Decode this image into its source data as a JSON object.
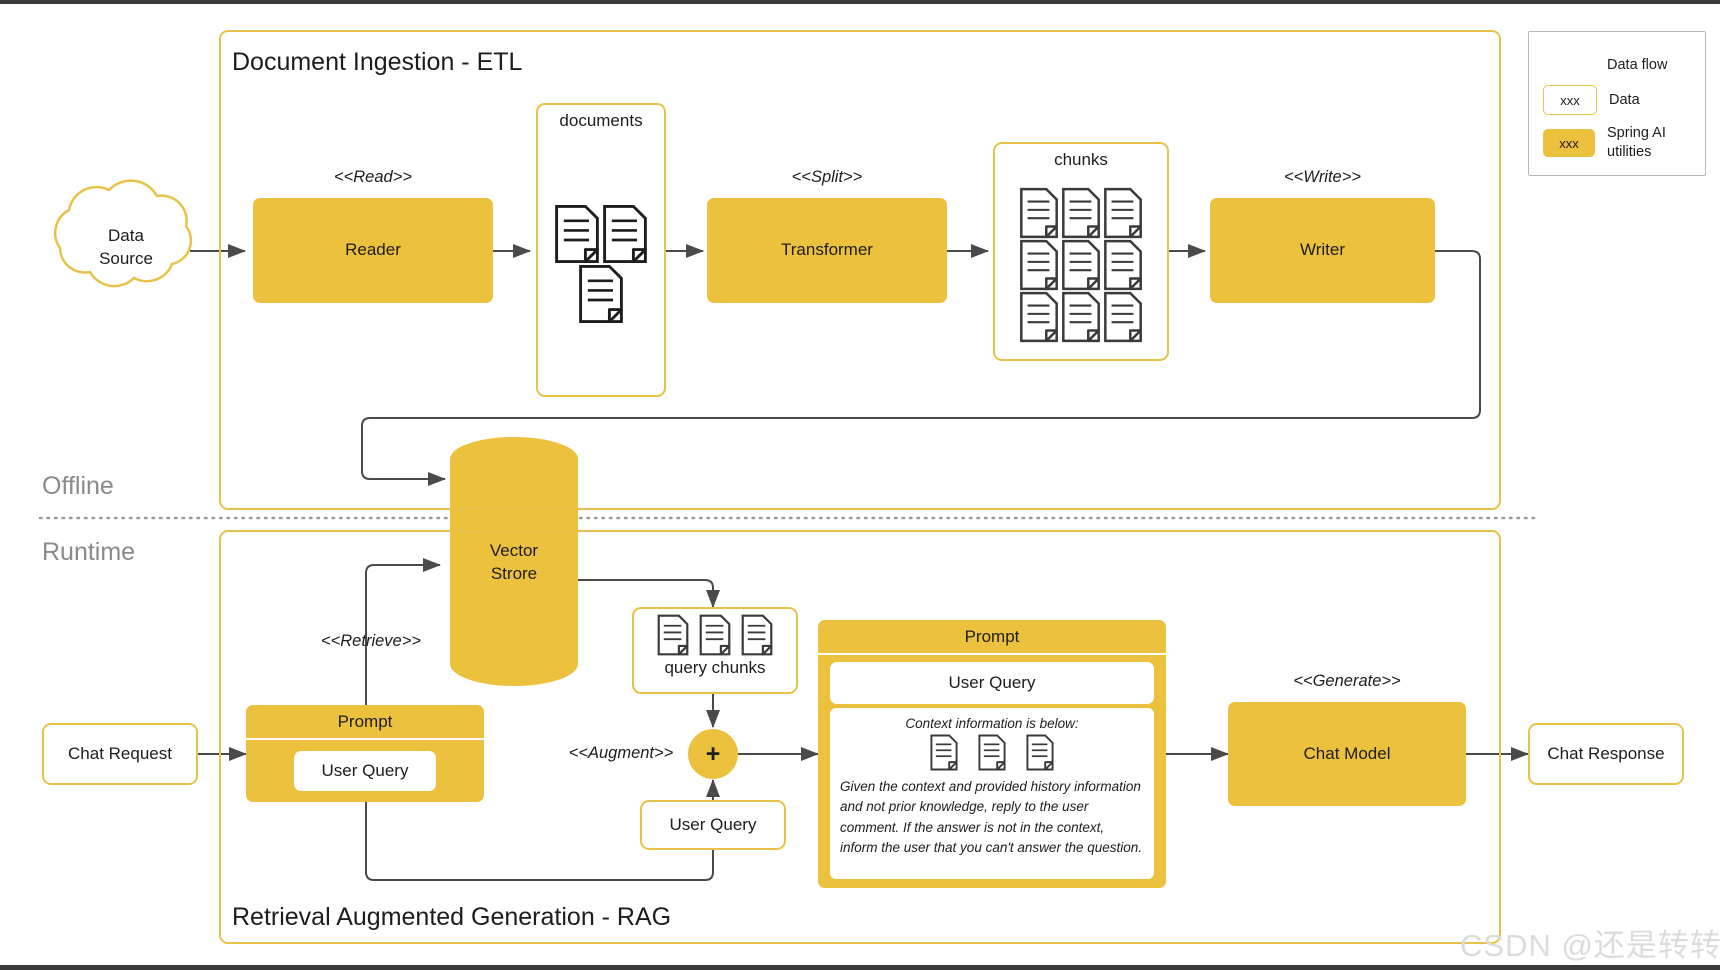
{
  "legend": {
    "rows": [
      {
        "kind": "arrow",
        "swatch_text": "",
        "label": "Data flow"
      },
      {
        "kind": "outline",
        "swatch_text": "xxx",
        "label": "Data"
      },
      {
        "kind": "fill",
        "swatch_text": "xxx",
        "label": "Spring AI utilities"
      }
    ]
  },
  "phases": {
    "offline": "Offline",
    "runtime": "Runtime"
  },
  "sections": {
    "etl_title": "Document Ingestion - ETL",
    "rag_title": "Retrieval Augmented Generation - RAG"
  },
  "etl": {
    "data_source": "Data\nSource",
    "read_stereotype": "<<Read>>",
    "reader": "Reader",
    "documents_title": "documents",
    "split_stereotype": "<<Split>>",
    "transformer": "Transformer",
    "chunks_title": "chunks",
    "write_stereotype": "<<Write>>",
    "writer": "Writer"
  },
  "store": {
    "vector_store": "Vector\nStrore"
  },
  "rag": {
    "chat_request": "Chat Request",
    "retrieve_stereotype": "<<Retrieve>>",
    "prompt_title": "Prompt",
    "prompt_user_query": "User Query",
    "query_chunks_label": "query chunks",
    "augment_stereotype": "<<Augment>>",
    "plus_symbol": "+",
    "user_query_box": "User Query",
    "big_prompt_title": "Prompt",
    "big_prompt_user_query": "User Query",
    "context_note": "Context information is below:",
    "context_text": "Given the context and provided history information and not prior knowledge, reply to the user comment. If the answer is not in the context, inform the user that you can't answer the question.",
    "generate_stereotype": "<<Generate>>",
    "chat_model": "Chat Model",
    "chat_response": "Chat Response"
  },
  "watermark": "CSDN @还是转转",
  "colors": {
    "accent_fill": "#ecc13d",
    "accent_border": "#e8c349",
    "arrow": "#4a4a4a",
    "text": "#1d1d1d",
    "muted": "#8a8a8a"
  }
}
